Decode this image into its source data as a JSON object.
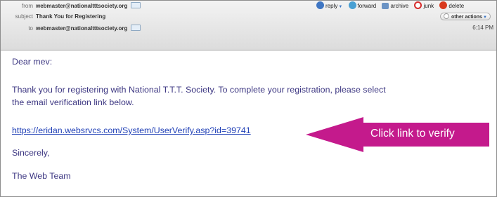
{
  "header": {
    "from_label": "from",
    "from_value": "webmaster@nationaltttsociety.org",
    "subject_label": "subject",
    "subject_value": "Thank You for Registering",
    "to_label": "to",
    "to_value": "webmaster@nationaltttsociety.org",
    "time": "6:14 PM"
  },
  "actions": {
    "reply": "reply",
    "forward": "forward",
    "archive": "archive",
    "junk": "junk",
    "delete": "delete",
    "other_actions": "other actions"
  },
  "body": {
    "greeting": "Dear mev:",
    "paragraph_line1": "Thank you for registering with National T.T.T. Society. To complete your registration, please select",
    "paragraph_line2": "the email verification link below.",
    "link": "https://eridan.websrvcs.com/System/UserVerify.asp?id=39741",
    "signoff": "Sincerely,",
    "signature": "The Web Team"
  },
  "callout": {
    "text": "Click link to verify",
    "color": "#c41a8c"
  }
}
